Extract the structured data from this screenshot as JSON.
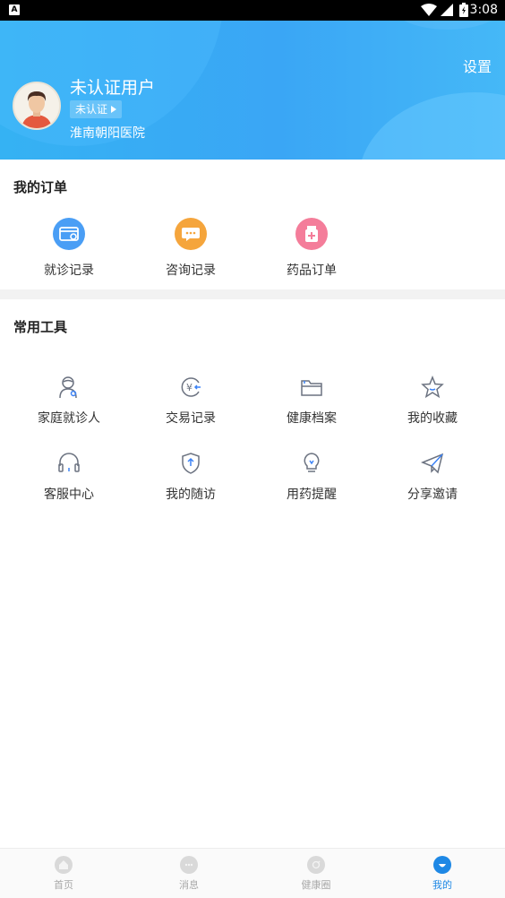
{
  "status_bar": {
    "time": "3:08",
    "notification_icon_text": "A"
  },
  "header": {
    "settings_label": "设置",
    "username": "未认证用户",
    "verify_badge": "未认证",
    "hospital": "淮南朝阳医院"
  },
  "orders": {
    "title": "我的订单",
    "items": [
      {
        "label": "就诊记录",
        "icon": "visit-record-icon",
        "color": "#4a9ef5"
      },
      {
        "label": "咨询记录",
        "icon": "consult-chat-icon",
        "color": "#f5a53c"
      },
      {
        "label": "药品订单",
        "icon": "medicine-box-icon",
        "color": "#f47d9a"
      }
    ]
  },
  "tools": {
    "title": "常用工具",
    "items": [
      {
        "label": "家庭就诊人",
        "icon": "family-patient-icon"
      },
      {
        "label": "交易记录",
        "icon": "transaction-yen-icon"
      },
      {
        "label": "健康档案",
        "icon": "folder-icon"
      },
      {
        "label": "我的收藏",
        "icon": "star-icon"
      },
      {
        "label": "客服中心",
        "icon": "headset-icon"
      },
      {
        "label": "我的随访",
        "icon": "shield-icon"
      },
      {
        "label": "用药提醒",
        "icon": "lightbulb-icon"
      },
      {
        "label": "分享邀请",
        "icon": "paper-plane-icon"
      }
    ]
  },
  "tabbar": {
    "items": [
      {
        "label": "首页",
        "icon": "home-icon",
        "active": false
      },
      {
        "label": "消息",
        "icon": "message-icon",
        "active": false
      },
      {
        "label": "健康圈",
        "icon": "health-circle-icon",
        "active": false
      },
      {
        "label": "我的",
        "icon": "profile-icon",
        "active": true
      }
    ],
    "active_color": "#1e88e5",
    "inactive_color": "#a8a8a8"
  }
}
